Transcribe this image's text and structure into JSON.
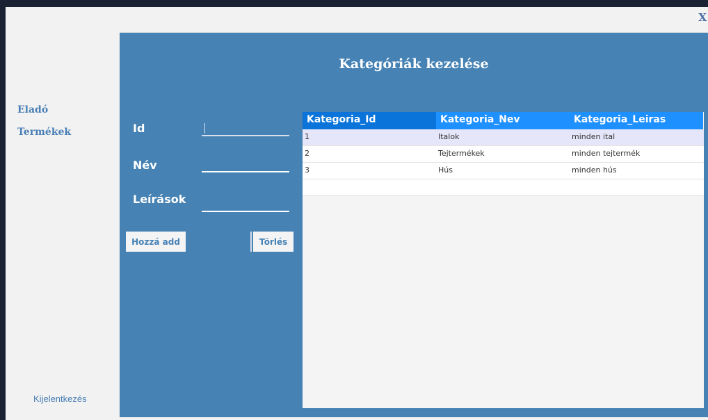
{
  "window": {
    "close_label": "X"
  },
  "sidebar": {
    "items": [
      {
        "label": "Eladó"
      },
      {
        "label": "Termékek"
      }
    ],
    "logout_label": "Kijelentkezés"
  },
  "panel": {
    "title": "Kategóriák kezelése",
    "fields": {
      "id_label": "Id",
      "id_value": "",
      "name_label": "Név",
      "name_value": "",
      "desc_label": "Leírások",
      "desc_value": ""
    },
    "buttons": {
      "add_label": "Hozzá add",
      "delete_label": "Törlés"
    }
  },
  "table": {
    "columns": [
      "Kategoria_Id",
      "Kategoria_Nev",
      "Kategoria_Leiras"
    ],
    "rows": [
      [
        "1",
        "Italok",
        "minden ital"
      ],
      [
        "2",
        "Tejtermékek",
        "minden tejtermék"
      ],
      [
        "3",
        "Hús",
        "minden hús"
      ]
    ]
  },
  "colors": {
    "panel_bg": "#4682b4",
    "header_bg": "#1e90ff",
    "selected_row_bg": "#e6e6fa"
  }
}
